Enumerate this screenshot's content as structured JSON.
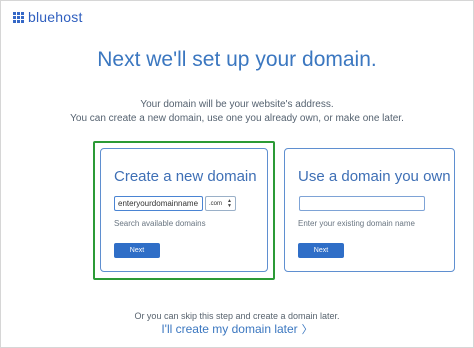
{
  "brand": {
    "name": "bluehost",
    "logo_icon": "grid-logo-icon",
    "color": "#3568c7"
  },
  "headline": "Next we'll set up your domain.",
  "intro": {
    "line1": "Your domain will be your website's address.",
    "line2": "You can create a new domain, use one you already own, or make one later."
  },
  "new_domain": {
    "title": "Create a new domain",
    "input_value": "enteryourdomainname",
    "tld_value": ".com",
    "helper": "Search available domains",
    "button": "Next",
    "highlight_color": "#2b9a36"
  },
  "own_domain": {
    "title": "Use a domain you own",
    "input_value": "",
    "helper": "Enter your existing domain name",
    "button": "Next"
  },
  "skip": {
    "text": "Or you can skip this step and create a domain later.",
    "link": "I'll create my domain later",
    "link_icon": "chevron-right-icon"
  },
  "accent_color": "#3b77c0"
}
